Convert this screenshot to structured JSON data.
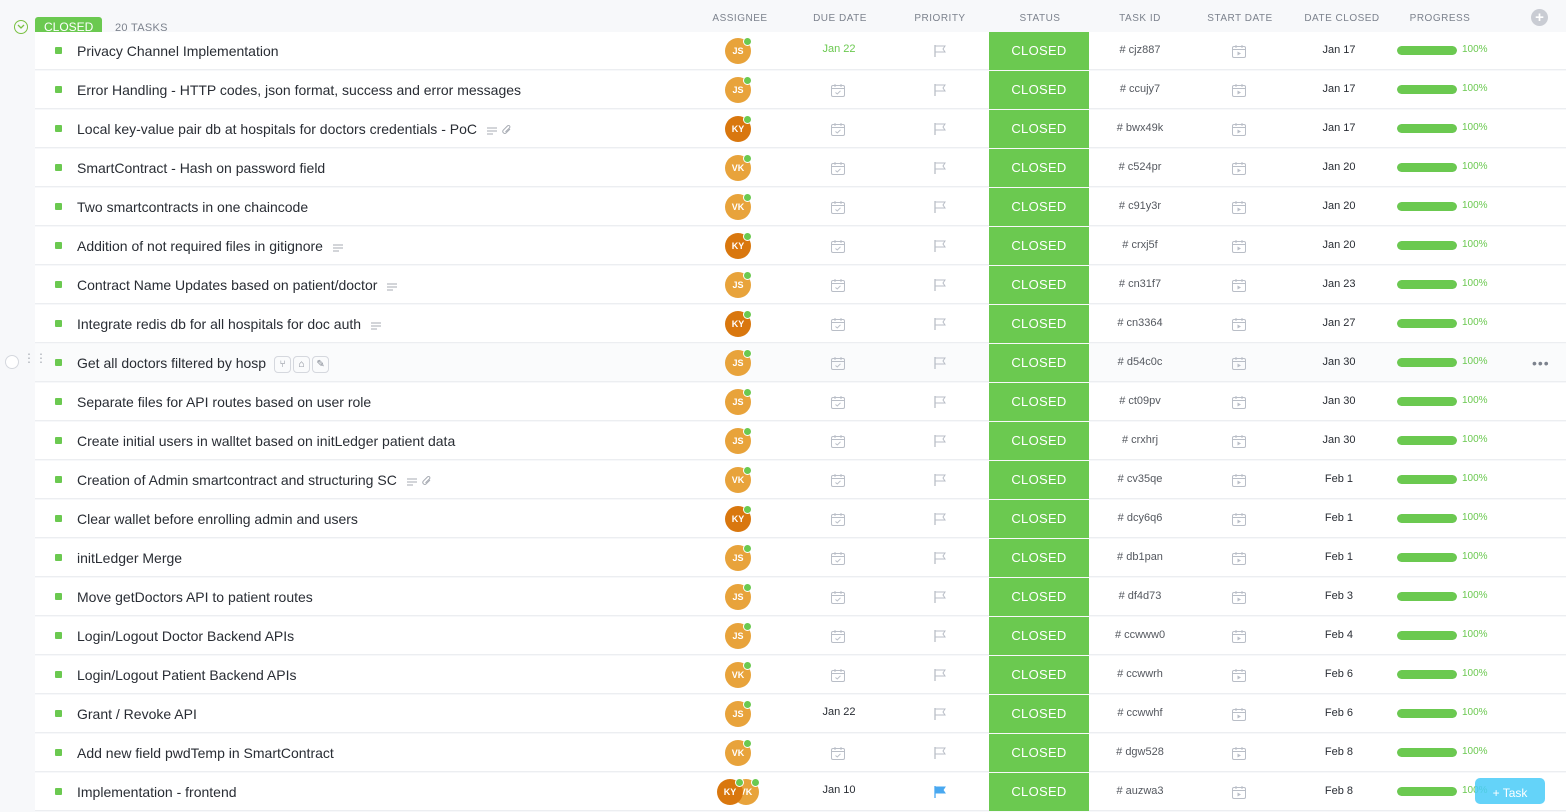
{
  "group": {
    "status": "CLOSED",
    "count_label": "20 TASKS"
  },
  "columns": {
    "assignee": "ASSIGNEE",
    "due_date": "DUE DATE",
    "priority": "PRIORITY",
    "status": "STATUS",
    "task_id": "TASK ID",
    "start_date": "START DATE",
    "date_closed": "DATE CLOSED",
    "progress": "PROGRESS"
  },
  "add_column_symbol": "+",
  "more_symbol": "•••",
  "new_task_label": "+ Task",
  "colors": {
    "closed": "#6bc950",
    "avatar_js": "#e8a33b",
    "avatar_vk": "#e8a33b",
    "avatar_ky": "#d9770e",
    "flag_blue": "#49a8f0"
  },
  "tasks": [
    {
      "name": "Privacy Channel Implementation",
      "assignees": [
        "JS"
      ],
      "due": "Jan 22",
      "due_green": true,
      "status": "CLOSED",
      "id": "# cjz887",
      "closed": "Jan 17",
      "progress": "100%"
    },
    {
      "name": "Error Handling - HTTP codes, json format, success and error messages",
      "assignees": [
        "JS"
      ],
      "due": "",
      "status": "CLOSED",
      "id": "# ccujy7",
      "closed": "Jan 17",
      "progress": "100%"
    },
    {
      "name": "Local key-value pair db at hospitals for doctors credentials - PoC",
      "assignees": [
        "KY"
      ],
      "due": "",
      "status": "CLOSED",
      "id": "# bwx49k",
      "closed": "Jan 17",
      "progress": "100%",
      "extras": [
        "description-icon",
        "attachment-icon"
      ]
    },
    {
      "name": "SmartContract - Hash on password field",
      "assignees": [
        "VK"
      ],
      "due": "",
      "status": "CLOSED",
      "id": "# c524pr",
      "closed": "Jan 20",
      "progress": "100%"
    },
    {
      "name": "Two smartcontracts in one chaincode",
      "assignees": [
        "VK"
      ],
      "due": "",
      "status": "CLOSED",
      "id": "# c91y3r",
      "closed": "Jan 20",
      "progress": "100%"
    },
    {
      "name": "Addition of not required files in gitignore",
      "assignees": [
        "KY"
      ],
      "due": "",
      "status": "CLOSED",
      "id": "# crxj5f",
      "closed": "Jan 20",
      "progress": "100%",
      "extras": [
        "description-icon"
      ]
    },
    {
      "name": "Contract Name Updates based on patient/doctor",
      "assignees": [
        "JS"
      ],
      "due": "",
      "status": "CLOSED",
      "id": "# cn31f7",
      "closed": "Jan 23",
      "progress": "100%",
      "extras": [
        "description-icon"
      ]
    },
    {
      "name": "Integrate redis db for all hospitals for doc auth",
      "assignees": [
        "KY"
      ],
      "due": "",
      "status": "CLOSED",
      "id": "# cn3364",
      "closed": "Jan 27",
      "progress": "100%",
      "extras": [
        "description-icon"
      ]
    },
    {
      "name": "Get all doctors filtered by hosp",
      "assignees": [
        "JS"
      ],
      "due": "",
      "status": "CLOSED",
      "id": "# d54c0c",
      "closed": "Jan 30",
      "progress": "100%",
      "hover": true
    },
    {
      "name": "Separate files for API routes based on user role",
      "assignees": [
        "JS"
      ],
      "due": "",
      "status": "CLOSED",
      "id": "# ct09pv",
      "closed": "Jan 30",
      "progress": "100%"
    },
    {
      "name": "Create initial users in walltet based on initLedger patient data",
      "assignees": [
        "JS"
      ],
      "due": "",
      "status": "CLOSED",
      "id": "# crxhrj",
      "closed": "Jan 30",
      "progress": "100%"
    },
    {
      "name": "Creation of Admin smartcontract and structuring SC",
      "assignees": [
        "VK"
      ],
      "due": "",
      "status": "CLOSED",
      "id": "# cv35qe",
      "closed": "Feb 1",
      "progress": "100%",
      "extras": [
        "description-icon",
        "attachment-icon"
      ]
    },
    {
      "name": "Clear wallet before enrolling admin and users",
      "assignees": [
        "KY"
      ],
      "due": "",
      "status": "CLOSED",
      "id": "# dcy6q6",
      "closed": "Feb 1",
      "progress": "100%"
    },
    {
      "name": "initLedger Merge",
      "assignees": [
        "JS"
      ],
      "due": "",
      "status": "CLOSED",
      "id": "# db1pan",
      "closed": "Feb 1",
      "progress": "100%"
    },
    {
      "name": "Move getDoctors API to patient routes",
      "assignees": [
        "JS"
      ],
      "due": "",
      "status": "CLOSED",
      "id": "# df4d73",
      "closed": "Feb 3",
      "progress": "100%"
    },
    {
      "name": "Login/Logout Doctor Backend APIs",
      "assignees": [
        "JS"
      ],
      "due": "",
      "status": "CLOSED",
      "id": "# ccwww0",
      "closed": "Feb 4",
      "progress": "100%"
    },
    {
      "name": "Login/Logout Patient Backend APIs",
      "assignees": [
        "VK"
      ],
      "due": "",
      "status": "CLOSED",
      "id": "# ccwwrh",
      "closed": "Feb 6",
      "progress": "100%"
    },
    {
      "name": "Grant / Revoke API",
      "assignees": [
        "JS"
      ],
      "due": "Jan 22",
      "status": "CLOSED",
      "id": "# ccwwhf",
      "closed": "Feb 6",
      "progress": "100%"
    },
    {
      "name": "Add new field pwdTemp in SmartContract",
      "assignees": [
        "VK"
      ],
      "due": "",
      "status": "CLOSED",
      "id": "# dgw528",
      "closed": "Feb 8",
      "progress": "100%"
    },
    {
      "name": "Implementation - frontend",
      "assignees": [
        "KY",
        "VK"
      ],
      "due": "Jan 10",
      "status": "CLOSED",
      "id": "# auzwa3",
      "closed": "Feb 8",
      "progress": "100%",
      "priority_flag": "blue"
    }
  ]
}
